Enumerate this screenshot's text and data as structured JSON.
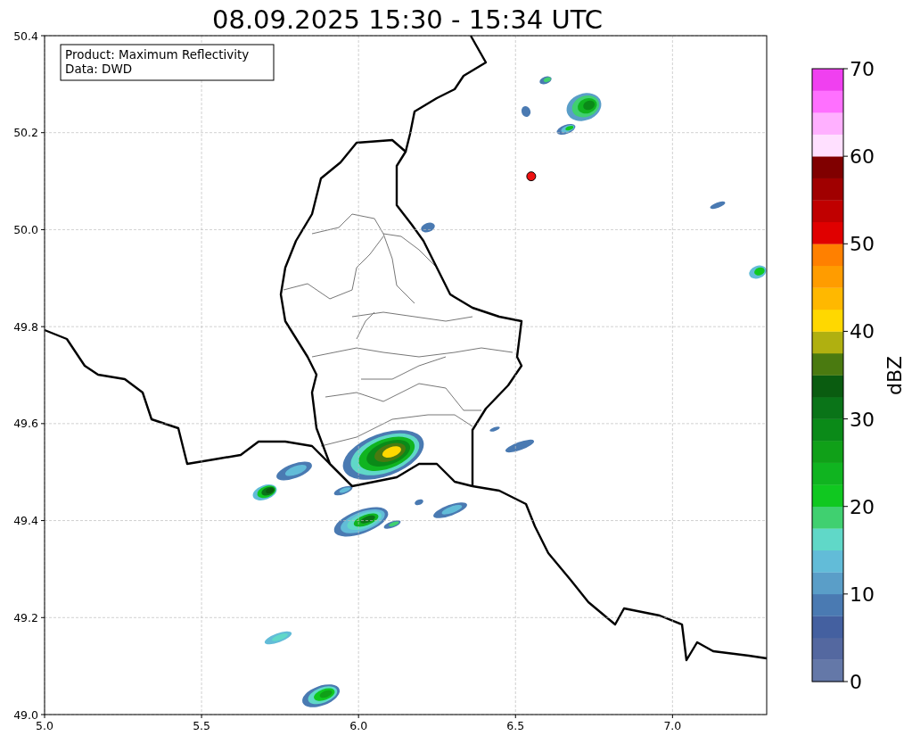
{
  "map_chart": {
    "chart_data": {
      "type": "scatter",
      "title": "08.09.2025 15:30 - 15:34 UTC",
      "x": [
        6.55
      ],
      "series": [
        {
          "color": "#ee1111",
          "values": [
            50.11
          ]
        }
      ],
      "grid": true,
      "xlim": [
        5,
        7.3
      ],
      "ylim": [
        49,
        50.4
      ],
      "xticks": [
        {
          "value": 5,
          "label": "5.0"
        },
        {
          "value": 5.5,
          "label": "5.5"
        },
        {
          "value": 6,
          "label": "6.0"
        },
        {
          "value": 6.5,
          "label": "6.5"
        },
        {
          "value": 7,
          "label": "7.0"
        }
      ],
      "yticks": [
        {
          "value": 49,
          "label": "49.0"
        },
        {
          "value": 49.2,
          "label": "49.2"
        },
        {
          "value": 49.4,
          "label": "49.4"
        },
        {
          "value": 49.6,
          "label": "49.6"
        },
        {
          "value": 49.8,
          "label": "49.8"
        },
        {
          "value": 50,
          "label": "50.0"
        },
        {
          "value": 50.2,
          "label": "50.2"
        },
        {
          "value": 50.4,
          "label": "50.4"
        }
      ]
    },
    "info_box": {
      "lines": [
        "Product: Maximum Reflectivity",
        "Data: DWD"
      ]
    }
  },
  "colorbar": {
    "label": "dBZ",
    "ticks": [
      "70",
      "60",
      "50",
      "40",
      "30",
      "20",
      "10",
      "0"
    ],
    "segments": [
      {
        "color": "#6478a8"
      },
      {
        "color": "#5468a0"
      },
      {
        "color": "#4460a0"
      },
      {
        "color": "#4a7ab2"
      },
      {
        "color": "#5a9ec8"
      },
      {
        "color": "#62bcd8"
      },
      {
        "color": "#60d8c8"
      },
      {
        "color": "#40d070"
      },
      {
        "color": "#10c820"
      },
      {
        "color": "#10b420"
      },
      {
        "color": "#10a018"
      },
      {
        "color": "#0a8a18"
      },
      {
        "color": "#0a7418"
      },
      {
        "color": "#0a5c10"
      },
      {
        "color": "#4a7a10"
      },
      {
        "color": "#b0b010"
      },
      {
        "color": "#ffd800"
      },
      {
        "color": "#ffb800"
      },
      {
        "color": "#ff9c00"
      },
      {
        "color": "#ff8000"
      },
      {
        "color": "#e00000"
      },
      {
        "color": "#c00000"
      },
      {
        "color": "#a00000"
      },
      {
        "color": "#800000"
      },
      {
        "color": "#ffe0ff"
      },
      {
        "color": "#ffb0ff"
      },
      {
        "color": "#ff70ff"
      },
      {
        "color": "#f040f0"
      }
    ]
  }
}
